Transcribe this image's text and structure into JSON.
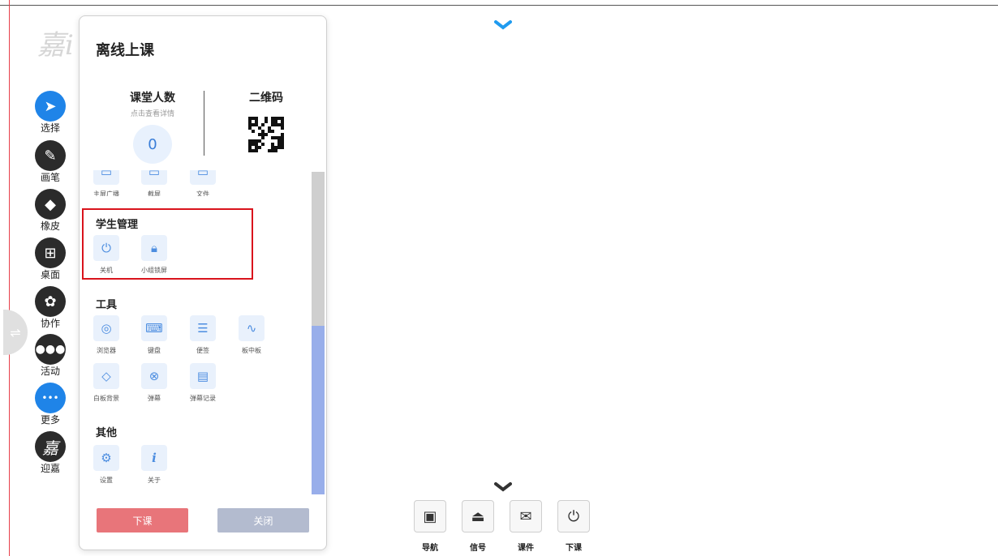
{
  "left_toolbar": {
    "items": [
      {
        "label": "选择",
        "icon": "cursor-icon"
      },
      {
        "label": "画笔",
        "icon": "pen-icon"
      },
      {
        "label": "橡皮",
        "icon": "eraser-icon"
      },
      {
        "label": "桌面",
        "icon": "windows-icon"
      },
      {
        "label": "协作",
        "icon": "collaboration-icon"
      },
      {
        "label": "活动",
        "icon": "people-icon"
      },
      {
        "label": "更多",
        "icon": "more-icon"
      },
      {
        "label": "迎嘉",
        "icon": "logo-icon"
      }
    ],
    "glyphs": {
      "cursor": "➤",
      "pen": "✎",
      "eraser": "◆",
      "windows": "⊞",
      "collab": "✿",
      "people": "👪",
      "more": "•••",
      "logo": "嘉"
    }
  },
  "panel": {
    "title": "离线上课",
    "class_count": {
      "title": "课堂人数",
      "subtitle": "点击查看详情",
      "value": "0"
    },
    "qr": {
      "title": "二维码"
    },
    "partial_row": [
      "主屏广播",
      "截屏",
      "文件"
    ],
    "student_mgmt": {
      "title": "学生管理",
      "items": [
        "关机",
        "小组锁屏"
      ]
    },
    "tools": {
      "title": "工具",
      "items": [
        "浏览器",
        "键盘",
        "便签",
        "板中板",
        "白板背景",
        "弹幕",
        "弹幕记录"
      ]
    },
    "other": {
      "title": "其他",
      "items": [
        "设置",
        "关于"
      ]
    },
    "buttons": {
      "end": "下课",
      "close": "关闭"
    }
  },
  "bottom_toolbar": {
    "items": [
      {
        "label": "导航",
        "icon": "grid-icon"
      },
      {
        "label": "信号",
        "icon": "signal-icon"
      },
      {
        "label": "课件",
        "icon": "courseware-icon"
      },
      {
        "label": "下课",
        "icon": "power-icon"
      }
    ]
  },
  "colors": {
    "accent_blue": "#1f84e8",
    "highlight_red": "#d9141c",
    "end_button": "#e8757a",
    "close_button": "#b3bbcf"
  }
}
